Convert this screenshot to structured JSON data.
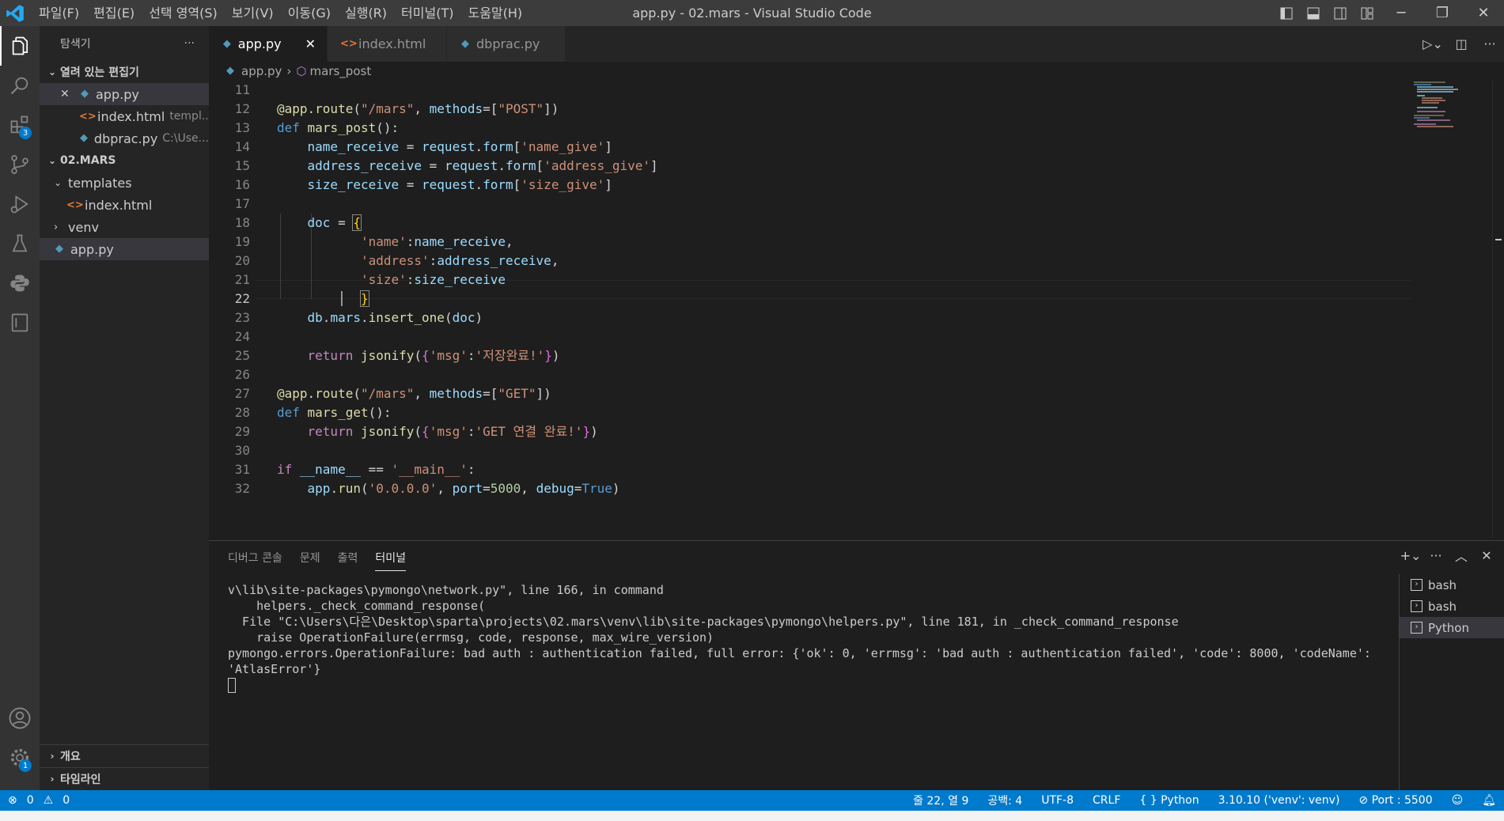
{
  "window": {
    "title": "app.py - 02.mars - Visual Studio Code",
    "menu": [
      "파일(F)",
      "편집(E)",
      "선택 영역(S)",
      "보기(V)",
      "이동(G)",
      "실행(R)",
      "터미널(T)",
      "도움말(H)"
    ]
  },
  "activity": {
    "extensions_badge": "3",
    "settings_badge": "1"
  },
  "sidebar": {
    "title": "탐색기",
    "more": "···",
    "open_editors_label": "열려 있는 편집기",
    "open_editors": [
      {
        "name": "app.py",
        "detail": ""
      },
      {
        "name": "index.html",
        "detail": "templ..."
      },
      {
        "name": "dbprac.py",
        "detail": "C:\\Use..."
      }
    ],
    "project_label": "02.MARS",
    "tree": {
      "templates": "templates",
      "index": "index.html",
      "venv": "venv",
      "app": "app.py"
    },
    "outline_label": "개요",
    "timeline_label": "타임라인"
  },
  "tabs": [
    {
      "label": "app.py"
    },
    {
      "label": "index.html"
    },
    {
      "label": "dbprac.py"
    }
  ],
  "breadcrumb": {
    "file": "app.py",
    "symbol": "mars_post"
  },
  "code": {
    "line_numbers": [
      "11",
      "12",
      "13",
      "14",
      "15",
      "16",
      "17",
      "18",
      "19",
      "20",
      "21",
      "22",
      "23",
      "24",
      "25",
      "26",
      "27",
      "28",
      "29",
      "30",
      "31",
      "32"
    ],
    "current_line": "22"
  },
  "panel": {
    "tabs": [
      "디버그 콘솔",
      "문제",
      "출력",
      "터미널"
    ],
    "active_tab": "터미널",
    "terminal_lines": [
      "v\\lib\\site-packages\\pymongo\\network.py\", line 166, in command",
      "    helpers._check_command_response(",
      "  File \"C:\\Users\\다은\\Desktop\\sparta\\projects\\02.mars\\venv\\lib\\site-packages\\pymongo\\helpers.py\", line 181, in _check_command_response",
      "    raise OperationFailure(errmsg, code, response, max_wire_version)",
      "pymongo.errors.OperationFailure: bad auth : authentication failed, full error: {'ok': 0, 'errmsg': 'bad auth : authentication failed', 'code': 8000, 'codeName':",
      "'AtlasError'}"
    ],
    "terminals": [
      "bash",
      "bash",
      "Python"
    ]
  },
  "status": {
    "errors": "0",
    "warnings": "0",
    "position": "줄 22, 열 9",
    "spaces": "공백: 4",
    "encoding": "UTF-8",
    "eol": "CRLF",
    "language": "Python",
    "interpreter": "3.10.10 ('venv': venv)",
    "port": "Port : 5500"
  }
}
